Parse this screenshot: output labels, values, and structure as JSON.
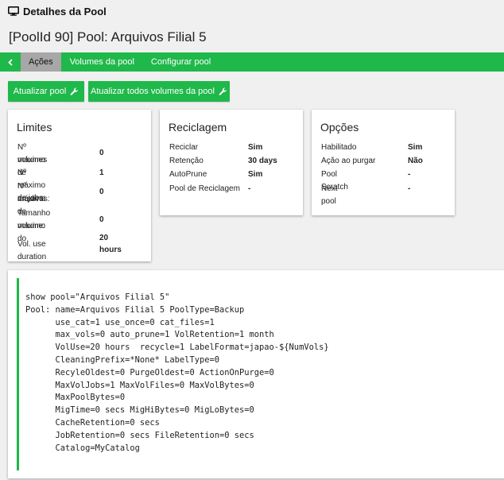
{
  "header": {
    "title": "Detalhes da Pool"
  },
  "page": {
    "title": "[PoolId 90] Pool: Arquivos Filial 5"
  },
  "nav": {
    "tabs": [
      {
        "label": "Ações",
        "active": true
      },
      {
        "label": "Volumes da pool",
        "active": false
      },
      {
        "label": "Configurar pool",
        "active": false
      }
    ]
  },
  "buttons": {
    "update_pool": "Atualizar pool",
    "update_all_volumes": "Atualizar todos volumes da pool"
  },
  "limites": {
    "title": "Limites",
    "rows": [
      {
        "label_1": "Nº máximo de",
        "label_2": "volumes",
        "value_1": "0"
      },
      {
        "label_1": "Nº máximo de jobs:",
        "value_1": "1"
      },
      {
        "label_1": "Nº máximo de",
        "label_2": "arquivos:",
        "value_1": "0"
      },
      {
        "label_1": "Tamanho máximo do",
        "label_2": "volume:",
        "value_1": "0"
      },
      {
        "label_1": "Vol. use duration",
        "value_1": "20",
        "value_2": "hours"
      }
    ]
  },
  "reciclagem": {
    "title": "Reciclagem",
    "rows": [
      {
        "label": "Reciclar",
        "value": "Sim"
      },
      {
        "label": "Retenção",
        "value": "30 days"
      },
      {
        "label": "AutoPrune",
        "value": "Sim"
      },
      {
        "label": "Pool de Reciclagem",
        "value": "-"
      }
    ]
  },
  "opcoes": {
    "title": "Opções",
    "rows": [
      {
        "label": "Habilitado",
        "value": "Sim"
      },
      {
        "label": "Ação ao purgar",
        "value": "Não"
      },
      {
        "label": "Pool Scratch",
        "value": "-"
      },
      {
        "label": "Next pool",
        "value": "-"
      }
    ]
  },
  "code": {
    "text": "show pool=\"Arquivos Filial 5\"\nPool: name=Arquivos Filial 5 PoolType=Backup\n      use_cat=1 use_once=0 cat_files=1\n      max_vols=0 auto_prune=1 VolRetention=1 month\n      VolUse=20 hours  recycle=1 LabelFormat=japao-${NumVols}\n      CleaningPrefix=*None* LabelType=0\n      RecyleOldest=0 PurgeOldest=0 ActionOnPurge=0\n      MaxVolJobs=1 MaxVolFiles=0 MaxVolBytes=0\n      MaxPoolBytes=0\n      MigTime=0 secs MigHiBytes=0 MigLoBytes=0\n      CacheRetention=0 secs\n      JobRetention=0 secs FileRetention=0 secs\n      Catalog=MyCatalog"
  },
  "colors": {
    "accent": "#1fb84a",
    "active_tab": "#a7a7a7"
  }
}
